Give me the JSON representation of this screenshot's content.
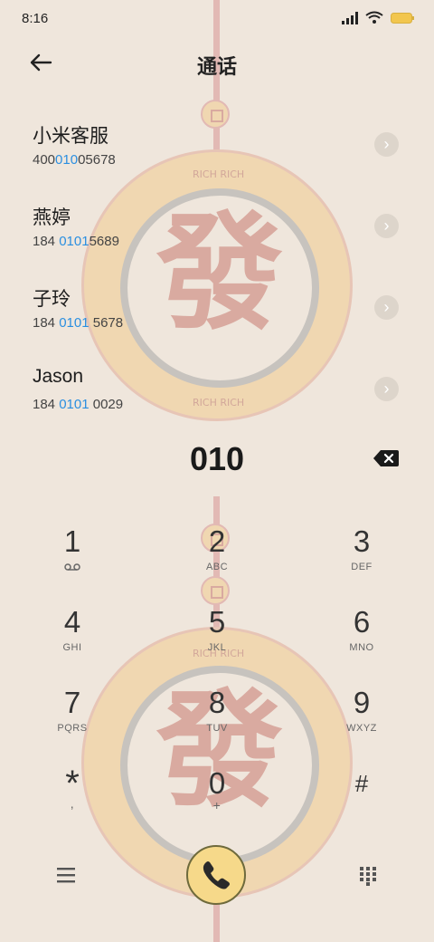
{
  "status": {
    "time": "8:16"
  },
  "header": {
    "title": "通话"
  },
  "contacts": [
    {
      "name": "小米客服",
      "pre": "400",
      "match": "010",
      "post": "05678"
    },
    {
      "name": "燕婷",
      "pre": "184 ",
      "match": "0101",
      "post": "5689"
    },
    {
      "name": "子玲",
      "pre": "184 ",
      "match": "0101",
      "post": " 5678"
    },
    {
      "name": "Jason",
      "pre": "184 ",
      "match": "0101",
      "post": " 0029"
    }
  ],
  "dial": {
    "number": "010"
  },
  "keypad": [
    {
      "digit": "1",
      "letters": ""
    },
    {
      "digit": "2",
      "letters": "ABC"
    },
    {
      "digit": "3",
      "letters": "DEF"
    },
    {
      "digit": "4",
      "letters": "GHI"
    },
    {
      "digit": "5",
      "letters": "JKL"
    },
    {
      "digit": "6",
      "letters": "MNO"
    },
    {
      "digit": "7",
      "letters": "PQRS"
    },
    {
      "digit": "8",
      "letters": "TUV"
    },
    {
      "digit": "9",
      "letters": "WXYZ"
    },
    {
      "digit": "*",
      "letters": ","
    },
    {
      "digit": "0",
      "letters": "+"
    },
    {
      "digit": "#",
      "letters": ""
    }
  ],
  "wallpaper": {
    "glyph": "發",
    "ring_text": "RICH RICH"
  },
  "colors": {
    "match": "#2b8fe0",
    "call_button": "#f6d98a",
    "background": "#efe6dc"
  },
  "icons": {
    "back": "arrow-left-icon",
    "backspace": "backspace-icon",
    "voicemail": "voicemail-icon",
    "menu": "menu-icon",
    "call": "phone-icon",
    "keypad": "keypad-icon"
  }
}
